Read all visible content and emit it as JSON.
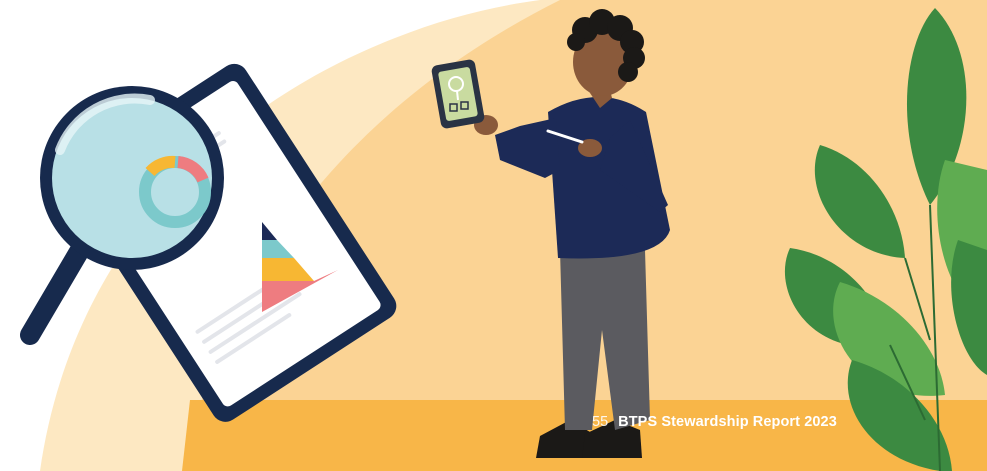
{
  "colors": {
    "light_bg": "#fde8c2",
    "mid_bg": "#fbd394",
    "floor": "#f8b648",
    "navy": "#172a4d",
    "sweater": "#1c2a57",
    "pants": "#5b5b60",
    "skin": "#8a5a3b",
    "hair": "#1b1917",
    "leaf_dark": "#3c8a41",
    "leaf_light": "#5fac51",
    "pyramid_teal": "#7cc9cb",
    "pyramid_yellow": "#f7b733",
    "pyramid_pink": "#ee7c80"
  },
  "illustration": {
    "elements": [
      "magnifying-glass-icon",
      "clipboard-report-icon",
      "donut-chart-icon",
      "pyramid-chart-icon",
      "person-with-tablet",
      "tree-checklist-icon",
      "plant-leaves"
    ]
  },
  "footer": {
    "page_number": "55",
    "report_title": "BTPS Stewardship Report 2023"
  }
}
